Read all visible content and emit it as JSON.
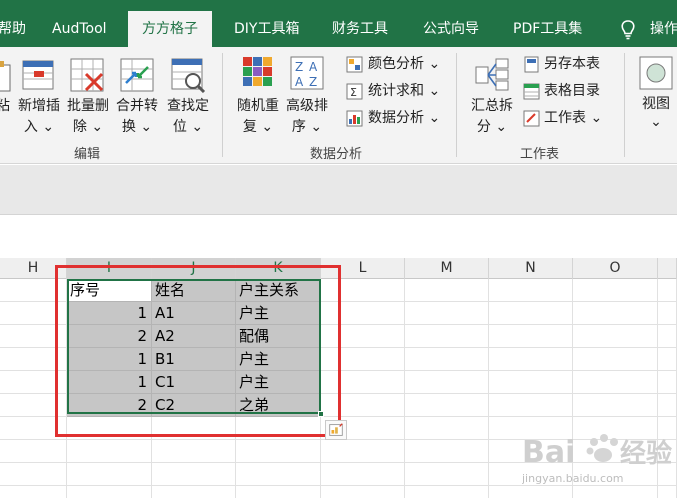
{
  "tabs": [
    {
      "label": "帮助"
    },
    {
      "label": "AudTool"
    },
    {
      "label": "方方格子",
      "active": true
    },
    {
      "label": "DIY工具箱"
    },
    {
      "label": "财务工具"
    },
    {
      "label": "公式向导"
    },
    {
      "label": "PDF工具集"
    },
    {
      "label": "操作"
    }
  ],
  "ribbon": {
    "edit_group": {
      "label": "编辑",
      "buttons": [
        {
          "line1": "粘",
          "line2": ""
        },
        {
          "line1": "新增插",
          "line2": "入 ⌄"
        },
        {
          "line1": "批量删",
          "line2": "除 ⌄"
        },
        {
          "line1": "合并转",
          "line2": "换 ⌄"
        },
        {
          "line1": "查找定",
          "line2": "位 ⌄"
        }
      ]
    },
    "analysis_group": {
      "label": "数据分析",
      "buttons": [
        {
          "line1": "随机重",
          "line2": "复 ⌄"
        },
        {
          "line1": "高级排",
          "line2": "序 ⌄"
        }
      ],
      "small_buttons": [
        "颜色分析 ⌄",
        "统计求和 ⌄",
        "数据分析 ⌄"
      ]
    },
    "sheet_group": {
      "label": "工作表",
      "buttons": [
        {
          "line1": "汇总拆",
          "line2": "分 ⌄"
        }
      ],
      "small_buttons": [
        "另存本表",
        "表格目录",
        "工作表 ⌄"
      ]
    },
    "view_group": {
      "line1": "视图",
      "line2": "⌄"
    }
  },
  "columns": [
    "H",
    "I",
    "J",
    "K",
    "L",
    "M",
    "N",
    "O"
  ],
  "table": {
    "headers": [
      "序号",
      "姓名",
      "户主关系"
    ],
    "rows": [
      [
        "1",
        "A1",
        "户主"
      ],
      [
        "2",
        "A2",
        "配偶"
      ],
      [
        "1",
        "B1",
        "户主"
      ],
      [
        "1",
        "C1",
        "户主"
      ],
      [
        "2",
        "C2",
        "之弟"
      ]
    ]
  },
  "watermark": {
    "brand": "Bai",
    "brand2": "经验",
    "url": "jingyan.baidu.com"
  },
  "colors": {
    "excel_green": "#217346",
    "highlight_red": "#e03030",
    "selection_gray": "#c6c6c6"
  }
}
